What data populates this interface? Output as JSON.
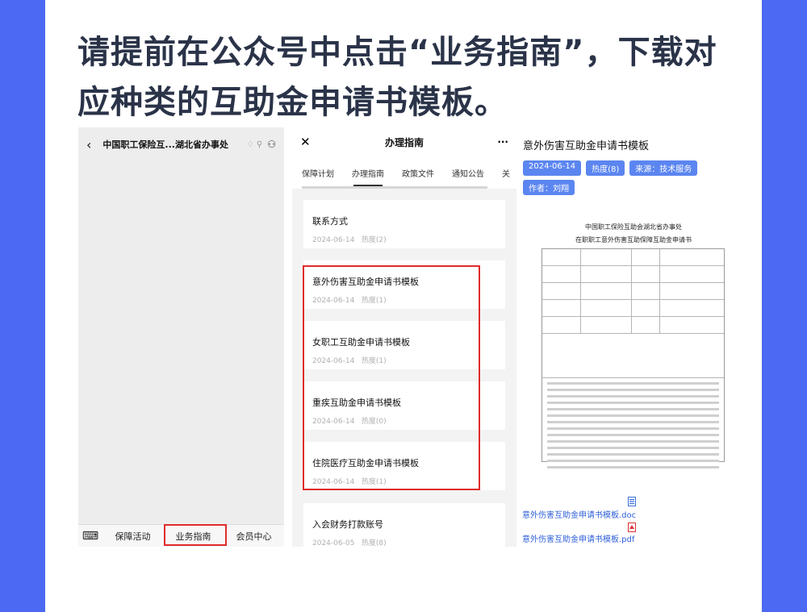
{
  "headline": "请提前在公众号中点击“业务指南”，下载对应种类的互助金申请书模板。",
  "phone1": {
    "title": "中国职工保险互...湖北省办事处",
    "menu": [
      "保障活动",
      "业务指南",
      "会员中心"
    ]
  },
  "phone2": {
    "title": "办理指南",
    "tabs": [
      "保障计划",
      "办理指南",
      "政策文件",
      "通知公告",
      "关"
    ],
    "items": [
      {
        "title": "联系方式",
        "date": "2024-06-14",
        "heat": "热度(2)"
      },
      {
        "title": "意外伤害互助金申请书模板",
        "date": "2024-06-14",
        "heat": "热度(1)"
      },
      {
        "title": "女职工互助金申请书模板",
        "date": "2024-06-14",
        "heat": "热度(1)"
      },
      {
        "title": "重疾互助金申请书模板",
        "date": "2024-06-14",
        "heat": "热度(0)"
      },
      {
        "title": "住院医疗互助金申请书模板",
        "date": "2024-06-14",
        "heat": "热度(1)"
      },
      {
        "title": "入会财务打款账号",
        "date": "2024-06-05",
        "heat": "热度(8)"
      }
    ]
  },
  "doc": {
    "title": "意外伤害互助金申请书模板",
    "tags": [
      "2024-06-14",
      "热度(8)",
      "来源：技术服务",
      "作者：刘翔"
    ],
    "form_org": "中国职工保险互助会湖北省办事处",
    "form_title": "在职职工意外伤害互助保障互助金申请书",
    "files": [
      "意外伤害互助金申请书模板.doc",
      "意外伤害互助金申请书模板.pdf"
    ]
  },
  "colors": {
    "accent": "#4b69f2",
    "highlight": "#e02b2b",
    "tag": "#5b85f0",
    "link": "#2e5fd8"
  }
}
